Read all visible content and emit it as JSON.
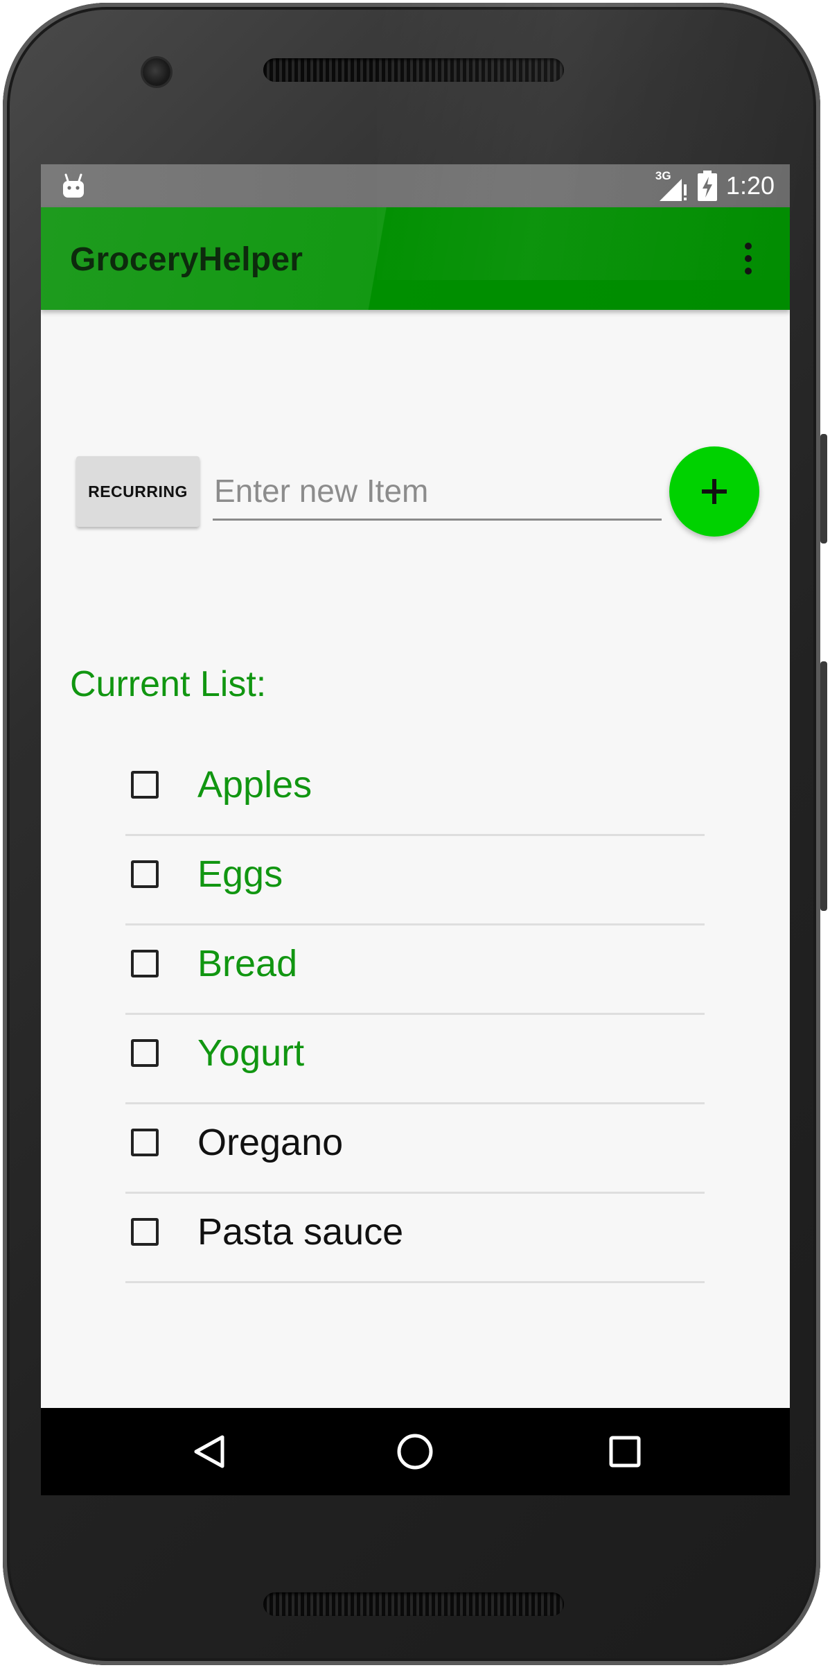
{
  "status_bar": {
    "network_label": "3G",
    "time": "1:20"
  },
  "app_bar": {
    "title": "GroceryHelper",
    "menu_icon": "overflow-menu-icon"
  },
  "input_row": {
    "recurring_button_label": "RECURRING",
    "item_placeholder": "Enter new Item",
    "add_icon": "plus-icon"
  },
  "list": {
    "heading": "Current List:",
    "items": [
      {
        "label": "Apples",
        "checked": false,
        "recurring": true
      },
      {
        "label": "Eggs",
        "checked": false,
        "recurring": true
      },
      {
        "label": "Bread",
        "checked": false,
        "recurring": true
      },
      {
        "label": "Yogurt",
        "checked": false,
        "recurring": true
      },
      {
        "label": "Oregano",
        "checked": false,
        "recurring": false
      },
      {
        "label": "Pasta sauce",
        "checked": false,
        "recurring": false
      }
    ]
  },
  "nav_bar": {
    "back_icon": "back-triangle-icon",
    "home_icon": "home-circle-icon",
    "recents_icon": "recents-square-icon"
  },
  "colors": {
    "app_bar": "#139913",
    "accent_green": "#119611",
    "fab": "#00d200"
  }
}
